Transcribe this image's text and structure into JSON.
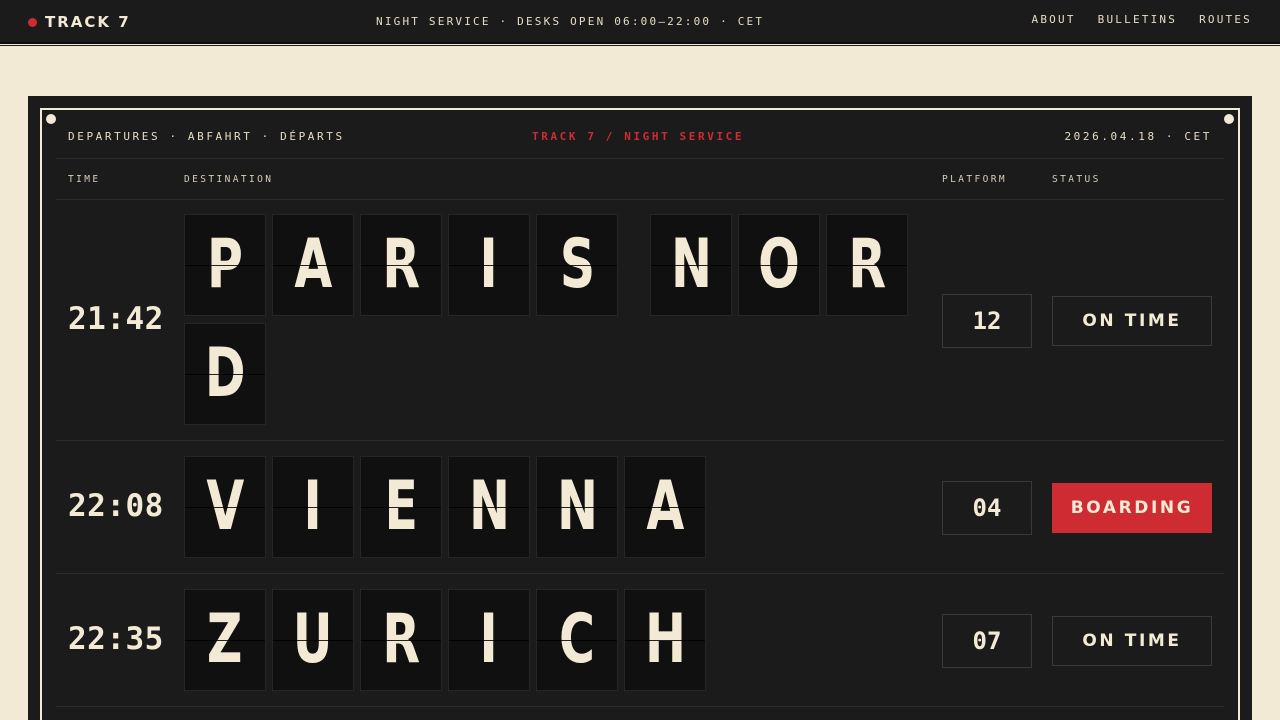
{
  "topbar": {
    "brand": "TRACK 7",
    "notice": "NIGHT SERVICE · DESKS OPEN 06:00–22:00 · CET",
    "nav": [
      "ABOUT",
      "BULLETINS",
      "ROUTES"
    ]
  },
  "board": {
    "header_left": "DEPARTURES · ABFAHRT · DÉPARTS",
    "header_center": "TRACK 7 / NIGHT SERVICE",
    "header_right": "2026.04.18 · CET",
    "columns": {
      "time": "TIME",
      "destination": "DESTINATION",
      "platform": "PLATFORM",
      "status": "STATUS"
    },
    "departures": [
      {
        "time": "21:42",
        "destination": [
          "P",
          "A",
          "R",
          "I",
          "S",
          "",
          "N",
          "O",
          "R",
          "D"
        ],
        "platform": "12",
        "status": "ON TIME",
        "status_kind": "on-time"
      },
      {
        "time": "22:08",
        "destination": [
          "V",
          "I",
          "E",
          "N",
          "N",
          "A"
        ],
        "platform": "04",
        "status": "BOARDING",
        "status_kind": "boarding"
      },
      {
        "time": "22:35",
        "destination": [
          "Z",
          "U",
          "R",
          "I",
          "C",
          "H"
        ],
        "platform": "07",
        "status": "ON TIME",
        "status_kind": "on-time"
      }
    ]
  },
  "colors": {
    "background": "#f3ead6",
    "board": "#1b1b1b",
    "flap": "#101010",
    "accent_red": "#cf2b33",
    "text_cream": "#f3ead6"
  }
}
